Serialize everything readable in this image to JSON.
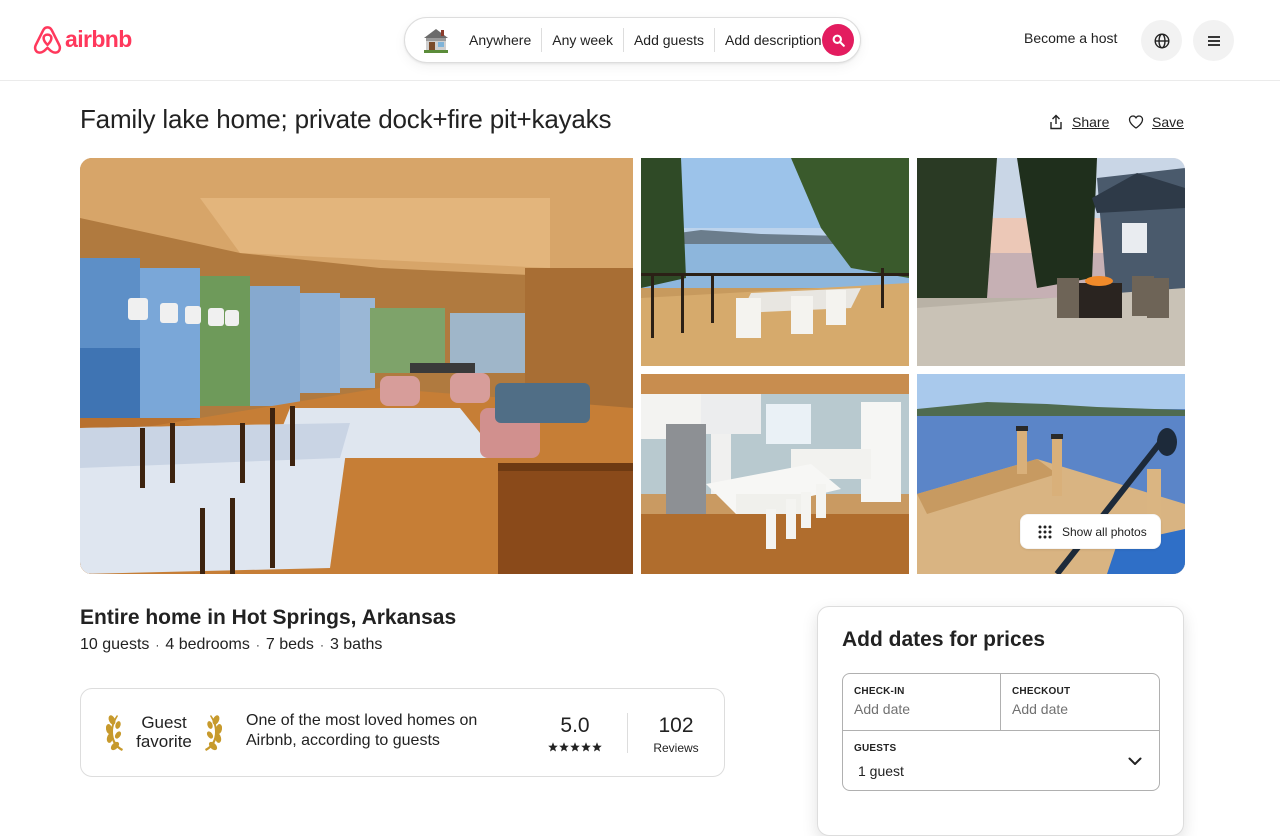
{
  "header": {
    "logo_text": "airbnb",
    "search": {
      "location": "Anywhere",
      "dates": "Any week",
      "guests": "Add guests",
      "description": "Add description"
    },
    "become_host": "Become a host"
  },
  "listing": {
    "title": "Family lake home; private dock+fire pit+kayaks",
    "share_label": "Share",
    "save_label": "Save",
    "show_all_photos": "Show all photos",
    "subtitle": "Entire home in Hot Springs, Arkansas",
    "details": [
      "10 guests",
      "4 bedrooms",
      "7 beds",
      "3 baths"
    ]
  },
  "guest_favorite": {
    "label_line1": "Guest",
    "label_line2": "favorite",
    "description": "One of the most loved homes on Airbnb, according to guests",
    "rating": "5.0",
    "stars": 5,
    "reviews_count": "102",
    "reviews_label": "Reviews"
  },
  "booking": {
    "title": "Add dates for prices",
    "checkin_label": "CHECK-IN",
    "checkin_value": "Add date",
    "checkout_label": "CHECKOUT",
    "checkout_value": "Add date",
    "guests_label": "GUESTS",
    "guests_value": "1 guest"
  },
  "colors": {
    "brand": "#FF385C",
    "search_button": "#E31C5F"
  }
}
